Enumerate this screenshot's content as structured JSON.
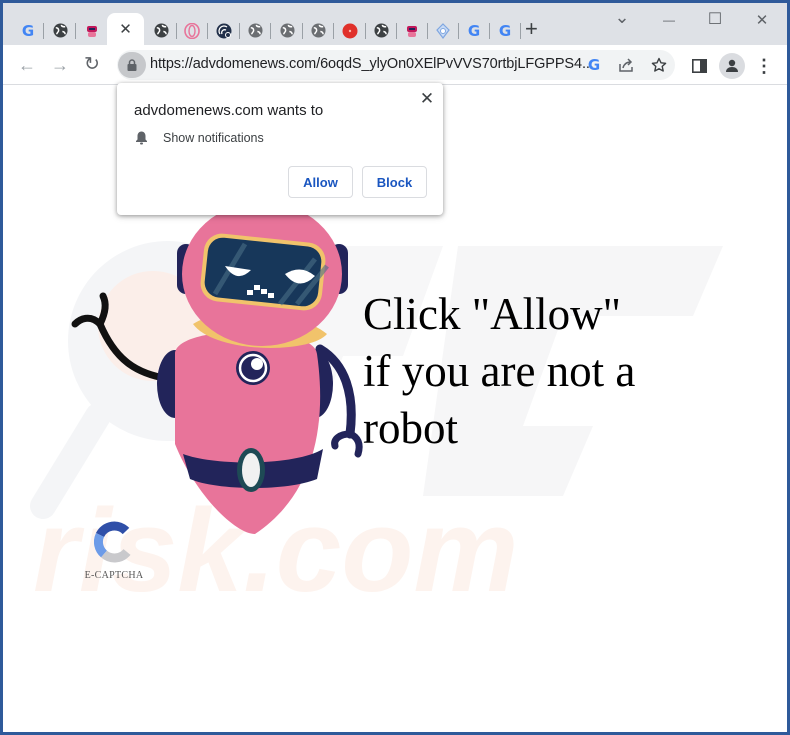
{
  "browser": {
    "tabs": [
      {
        "icon": "google-icon",
        "active": false
      },
      {
        "icon": "globe-icon",
        "active": false
      },
      {
        "icon": "robot-favicon-icon",
        "active": false
      },
      {
        "icon": "close-icon",
        "active": true,
        "close_glyph": "✕"
      },
      {
        "icon": "globe-icon",
        "active": false
      },
      {
        "icon": "opera-icon",
        "active": false
      },
      {
        "icon": "wifi-badge-icon",
        "active": false
      },
      {
        "icon": "globe-icon",
        "active": false
      },
      {
        "icon": "globe-icon",
        "active": false
      },
      {
        "icon": "globe-icon",
        "active": false
      },
      {
        "icon": "red-circle-icon",
        "active": false
      },
      {
        "icon": "globe-icon",
        "active": false
      },
      {
        "icon": "robot-favicon-icon",
        "active": false
      },
      {
        "icon": "bell-shield-icon",
        "active": false
      },
      {
        "icon": "google-icon",
        "active": false
      },
      {
        "icon": "google-icon",
        "active": false
      }
    ],
    "new_tab_glyph": "+",
    "window_controls": {
      "tab_search": "⌄",
      "minimize": "—",
      "maximize": "☐",
      "close": "✕"
    },
    "nav": {
      "back": "←",
      "forward": "→",
      "reload": "↻"
    },
    "url": "https://advdomenews.com/6oqdS_ylyOn0XElPvVVS70rtbjLFGPPS4...",
    "menu_glyph": "⋮"
  },
  "popup": {
    "title": "advdomenews.com wants to",
    "permission": "Show notifications",
    "allow_label": "Allow",
    "block_label": "Block",
    "close_glyph": "✕"
  },
  "page": {
    "headline_lines": [
      "Click \"Allow\"",
      "if you are not a",
      "robot"
    ],
    "captcha_label": "E-CAPTCHA",
    "watermark_text": "risk.com"
  },
  "colors": {
    "robot_pink": "#e8749a",
    "robot_navy": "#22245a",
    "robot_collar": "#f1c36b",
    "link_blue": "#1a56c0",
    "window_frame": "#2f5a9a"
  }
}
